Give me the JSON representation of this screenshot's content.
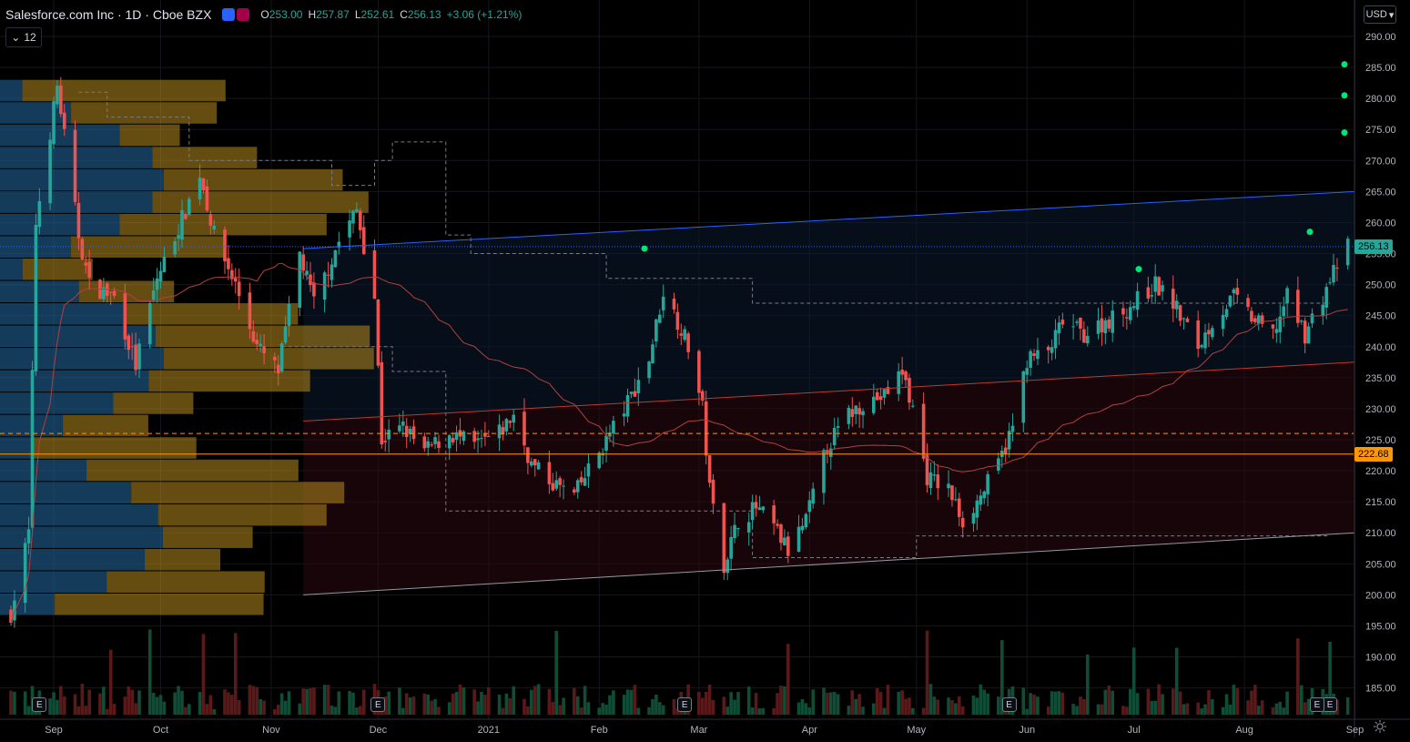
{
  "header": {
    "symbol_title": "Salesforce.com Inc · 1D · Cboe BZX",
    "ohlc": {
      "o_label": "O",
      "o_value": "253.00",
      "h_label": "H",
      "h_value": "257.87",
      "l_label": "L",
      "l_value": "252.61",
      "c_label": "C",
      "c_value": "256.13",
      "change": "+3.06 (+1.21%)"
    },
    "collapse_count": "12",
    "currency": "USD"
  },
  "colors": {
    "background": "#000000",
    "up": "#26a69a",
    "down": "#ef5350",
    "accent_orange": "#ff9800",
    "blue_trend": "#2962ff",
    "vp_blue": "#1e5a8a",
    "vp_orange": "#b88a1f"
  },
  "icons": [
    "market-status-icon",
    "data-delay-icon",
    "earnings-icon",
    "settings-icon"
  ],
  "chart_data": {
    "type": "candlestick",
    "title": "Salesforce.com Inc · 1D · Cboe BZX",
    "y_axis": {
      "min": 180,
      "max": 295,
      "side": "right",
      "ticks": [
        "185.00",
        "190.00",
        "195.00",
        "200.00",
        "205.00",
        "210.00",
        "215.00",
        "220.00",
        "225.00",
        "230.00",
        "235.00",
        "240.00",
        "245.00",
        "250.00",
        "255.00",
        "260.00",
        "265.00",
        "270.00",
        "275.00",
        "280.00",
        "285.00",
        "290.00"
      ],
      "last_price_label": "256.13",
      "level_label": "222.68"
    },
    "x_axis": {
      "labels": [
        "Sep",
        "Oct",
        "Nov",
        "Dec",
        "2021",
        "Feb",
        "Mar",
        "Apr",
        "May",
        "Jun",
        "Jul",
        "Aug",
        "Sep"
      ]
    },
    "price_path": [
      [
        "2020-08-20",
        197
      ],
      [
        "2020-08-25",
        210
      ],
      [
        "2020-08-27",
        260
      ],
      [
        "2020-09-02",
        282
      ],
      [
        "2020-09-08",
        258
      ],
      [
        "2020-09-11",
        250
      ],
      [
        "2020-09-18",
        248
      ],
      [
        "2020-09-24",
        237
      ],
      [
        "2020-09-30",
        251
      ],
      [
        "2020-10-08",
        262
      ],
      [
        "2020-10-12",
        268
      ],
      [
        "2020-10-16",
        258
      ],
      [
        "2020-10-22",
        250
      ],
      [
        "2020-10-28",
        240
      ],
      [
        "2020-11-03",
        236
      ],
      [
        "2020-11-09",
        255
      ],
      [
        "2020-11-13",
        247
      ],
      [
        "2020-11-20",
        257
      ],
      [
        "2020-11-25",
        262
      ],
      [
        "2020-11-30",
        248
      ],
      [
        "2020-12-02",
        225
      ],
      [
        "2020-12-08",
        227
      ],
      [
        "2020-12-14",
        223
      ],
      [
        "2020-12-21",
        226
      ],
      [
        "2020-12-28",
        224
      ],
      [
        "2021-01-04",
        226
      ],
      [
        "2021-01-08",
        229
      ],
      [
        "2021-01-13",
        221
      ],
      [
        "2021-01-19",
        218
      ],
      [
        "2021-01-25",
        216
      ],
      [
        "2021-01-29",
        220
      ],
      [
        "2021-02-04",
        226
      ],
      [
        "2021-02-09",
        231
      ],
      [
        "2021-02-15",
        238
      ],
      [
        "2021-02-19",
        249
      ],
      [
        "2021-02-24",
        243
      ],
      [
        "2021-02-26",
        240
      ],
      [
        "2021-03-02",
        230
      ],
      [
        "2021-03-04",
        217
      ],
      [
        "2021-03-08",
        205
      ],
      [
        "2021-03-12",
        212
      ],
      [
        "2021-03-17",
        214
      ],
      [
        "2021-03-22",
        211
      ],
      [
        "2021-03-26",
        207
      ],
      [
        "2021-03-31",
        212
      ],
      [
        "2021-04-06",
        224
      ],
      [
        "2021-04-12",
        229
      ],
      [
        "2021-04-16",
        231
      ],
      [
        "2021-04-22",
        232
      ],
      [
        "2021-04-27",
        236
      ],
      [
        "2021-04-30",
        230
      ],
      [
        "2021-05-04",
        219
      ],
      [
        "2021-05-10",
        217
      ],
      [
        "2021-05-14",
        212
      ],
      [
        "2021-05-18",
        215
      ],
      [
        "2021-05-24",
        221
      ],
      [
        "2021-05-28",
        227
      ],
      [
        "2021-06-01",
        238
      ],
      [
        "2021-06-07",
        239
      ],
      [
        "2021-06-11",
        244
      ],
      [
        "2021-06-17",
        242
      ],
      [
        "2021-06-23",
        244
      ],
      [
        "2021-06-29",
        246
      ],
      [
        "2021-07-07",
        250
      ],
      [
        "2021-07-12",
        247
      ],
      [
        "2021-07-19",
        240
      ],
      [
        "2021-07-23",
        244
      ],
      [
        "2021-07-29",
        248
      ],
      [
        "2021-08-04",
        244
      ],
      [
        "2021-08-09",
        242
      ],
      [
        "2021-08-13",
        248
      ],
      [
        "2021-08-18",
        242
      ],
      [
        "2021-08-23",
        248
      ],
      [
        "2021-08-26",
        252
      ],
      [
        "2021-08-30",
        256.13
      ]
    ],
    "price_markers": [
      255.8,
      258.5,
      252.5,
      280.5,
      274.5,
      285.5
    ],
    "trend_lines": [
      {
        "name": "",
        "from": [
          "2020-11-10",
          255.8
        ],
        "to": [
          "2021-09-01",
          265
        ]
      },
      {
        "name": "",
        "from": [
          "2020-11-10",
          228
        ],
        "to": [
          "2021-09-01",
          237.5
        ]
      },
      {
        "name": "",
        "from": [
          "2020-11-10",
          200
        ],
        "to": [
          "2021-09-01",
          210
        ]
      }
    ],
    "horizontal_levels": [
      226,
      222.68
    ]
  }
}
